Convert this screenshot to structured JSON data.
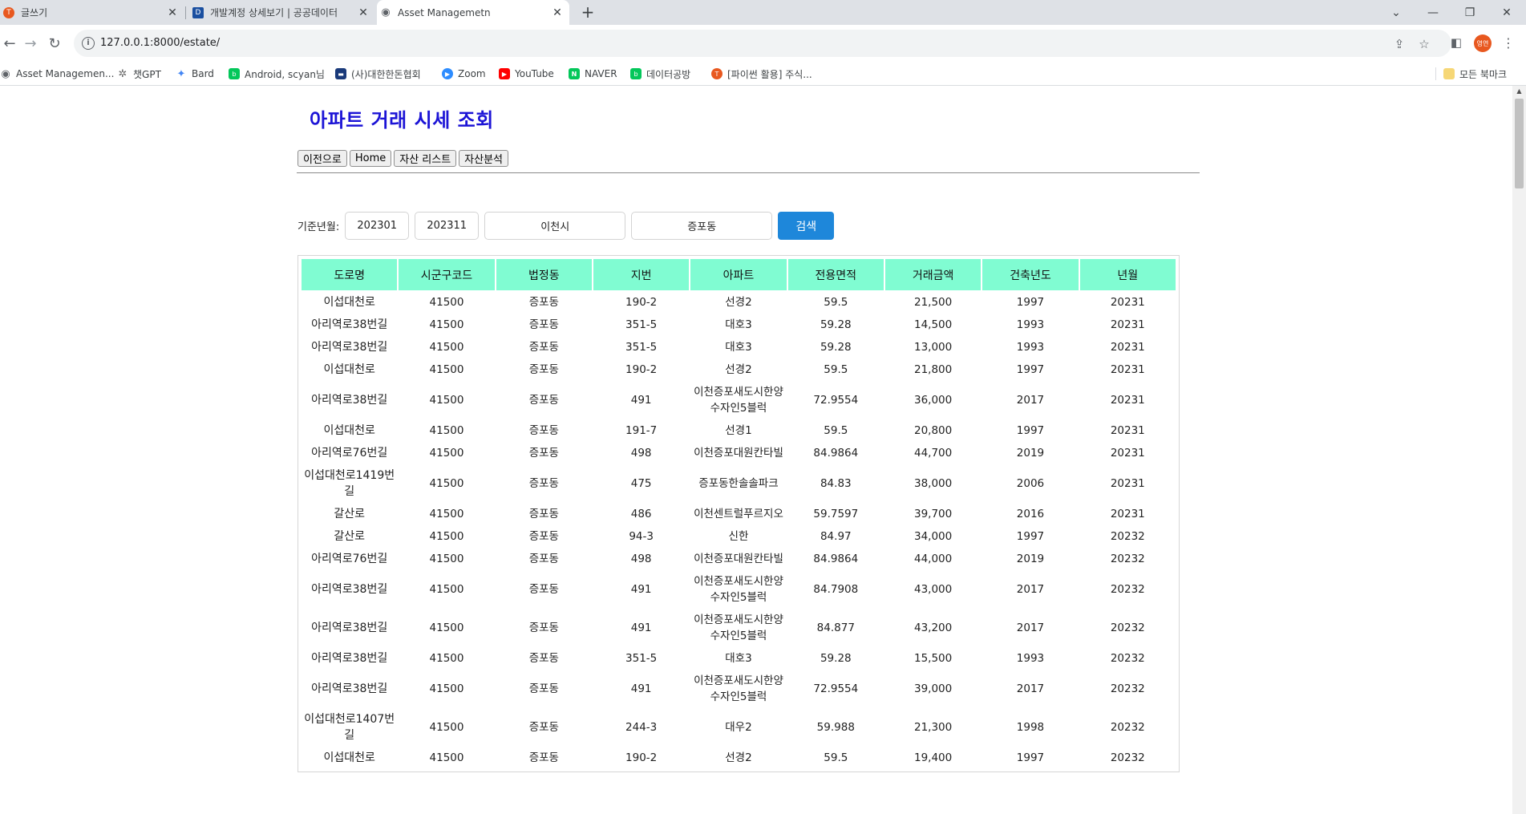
{
  "browser": {
    "tabs": [
      {
        "label": "글쓰기",
        "favicon_color": "#e8581f",
        "favicon_char": "T"
      },
      {
        "label": "개발계정 상세보기 | 공공데이터",
        "favicon_color": "#1a4fa0",
        "favicon_char": "D"
      },
      {
        "label": "Asset Managemetn",
        "favicon_color": "#5f6368",
        "favicon_char": "◉"
      }
    ],
    "new_tab": "+",
    "window_controls": {
      "chevron": "⌄",
      "minimize": "—",
      "restore": "❐",
      "close": "✕"
    },
    "url": "127.0.0.1:8000/estate/",
    "profile_label": "영연",
    "bookmarks": [
      {
        "label": "Asset Managemen...",
        "color": "#5f6368",
        "char": "◉"
      },
      {
        "label": "챗GPT",
        "color": "#6b6b6b",
        "char": "✲"
      },
      {
        "label": "Bard",
        "color": "#4285f4",
        "char": "✦"
      },
      {
        "label": "Android, scyan님",
        "color": "#03c75a",
        "char": "b"
      },
      {
        "label": "(사)대한한돈협회",
        "color": "#1a3a7a",
        "char": "▬"
      },
      {
        "label": "Zoom",
        "color": "#2d8cff",
        "char": "▶"
      },
      {
        "label": "YouTube",
        "color": "#ff0000",
        "char": "▶"
      },
      {
        "label": "NAVER",
        "color": "#03c75a",
        "char": "N"
      },
      {
        "label": "데이터공방",
        "color": "#03c75a",
        "char": "b"
      },
      {
        "label": "[파이썬 활용] 주식...",
        "color": "#e8581f",
        "char": "T"
      }
    ],
    "bookmarks_folder": "모든 북마크"
  },
  "page": {
    "title": "아파트 거래 시세 조회",
    "nav_buttons": [
      "이전으로",
      "Home",
      "자산 리스트",
      "자산분석"
    ],
    "search": {
      "label": "기준년월:",
      "start": "202301",
      "end": "202311",
      "city": "이천시",
      "dong": "증포동",
      "button": "검색"
    },
    "table": {
      "headers": [
        "도로명",
        "시군구코드",
        "법정동",
        "지번",
        "아파트",
        "전용면적",
        "거래금액",
        "건축년도",
        "년월"
      ],
      "rows": [
        [
          "이섭대천로",
          "41500",
          "증포동",
          "190-2",
          "선경2",
          "59.5",
          "21,500",
          "1997",
          "20231"
        ],
        [
          "아리역로38번길",
          "41500",
          "증포동",
          "351-5",
          "대호3",
          "59.28",
          "14,500",
          "1993",
          "20231"
        ],
        [
          "아리역로38번길",
          "41500",
          "증포동",
          "351-5",
          "대호3",
          "59.28",
          "13,000",
          "1993",
          "20231"
        ],
        [
          "이섭대천로",
          "41500",
          "증포동",
          "190-2",
          "선경2",
          "59.5",
          "21,800",
          "1997",
          "20231"
        ],
        [
          "아리역로38번길",
          "41500",
          "증포동",
          "491",
          "이천증포새도시한양수자인5블럭",
          "72.9554",
          "36,000",
          "2017",
          "20231"
        ],
        [
          "이섭대천로",
          "41500",
          "증포동",
          "191-7",
          "선경1",
          "59.5",
          "20,800",
          "1997",
          "20231"
        ],
        [
          "아리역로76번길",
          "41500",
          "증포동",
          "498",
          "이천증포대원칸타빌",
          "84.9864",
          "44,700",
          "2019",
          "20231"
        ],
        [
          "이섭대천로1419번길",
          "41500",
          "증포동",
          "475",
          "증포동한솔솔파크",
          "84.83",
          "38,000",
          "2006",
          "20231"
        ],
        [
          "갈산로",
          "41500",
          "증포동",
          "486",
          "이천센트럴푸르지오",
          "59.7597",
          "39,700",
          "2016",
          "20231"
        ],
        [
          "갈산로",
          "41500",
          "증포동",
          "94-3",
          "신한",
          "84.97",
          "34,000",
          "1997",
          "20232"
        ],
        [
          "아리역로76번길",
          "41500",
          "증포동",
          "498",
          "이천증포대원칸타빌",
          "84.9864",
          "44,000",
          "2019",
          "20232"
        ],
        [
          "아리역로38번길",
          "41500",
          "증포동",
          "491",
          "이천증포새도시한양수자인5블럭",
          "84.7908",
          "43,000",
          "2017",
          "20232"
        ],
        [
          "아리역로38번길",
          "41500",
          "증포동",
          "491",
          "이천증포새도시한양수자인5블럭",
          "84.877",
          "43,200",
          "2017",
          "20232"
        ],
        [
          "아리역로38번길",
          "41500",
          "증포동",
          "351-5",
          "대호3",
          "59.28",
          "15,500",
          "1993",
          "20232"
        ],
        [
          "아리역로38번길",
          "41500",
          "증포동",
          "491",
          "이천증포새도시한양수자인5블럭",
          "72.9554",
          "39,000",
          "2017",
          "20232"
        ],
        [
          "이섭대천로1407번길",
          "41500",
          "증포동",
          "244-3",
          "대우2",
          "59.988",
          "21,300",
          "1998",
          "20232"
        ],
        [
          "이섭대천로",
          "41500",
          "증포동",
          "190-2",
          "선경2",
          "59.5",
          "19,400",
          "1997",
          "20232"
        ]
      ]
    }
  }
}
